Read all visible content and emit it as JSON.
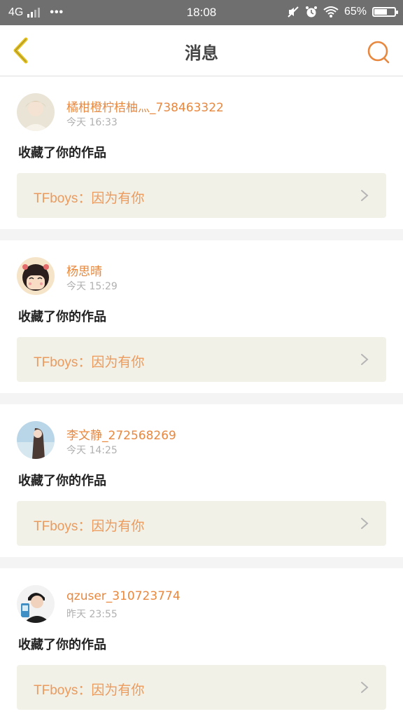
{
  "status_bar": {
    "network": "4G",
    "time": "18:08",
    "battery_percent": "65%",
    "battery_level": 0.65,
    "icons": [
      "signal-icon",
      "more-dots-icon",
      "mute-icon",
      "alarm-icon",
      "wifi-icon",
      "battery-icon"
    ]
  },
  "header": {
    "title": "消息",
    "back_icon": "chevron-left-icon",
    "search_icon": "search-icon"
  },
  "colors": {
    "accent": "#e8883f",
    "back_icon": "#e6c21c",
    "card_bg": "#f2f1e8"
  },
  "messages": [
    {
      "username": "橘柑橙柠桔柚灬_738463322",
      "time": "今天 16:33",
      "action": "收藏了你的作品",
      "work_title": "TFboys：因为有你"
    },
    {
      "username": "杨思晴",
      "time": "今天 15:29",
      "action": "收藏了你的作品",
      "work_title": "TFboys：因为有你"
    },
    {
      "username": "李文静_272568269",
      "time": "今天 14:25",
      "action": "收藏了你的作品",
      "work_title": "TFboys：因为有你"
    },
    {
      "username": "qzuser_310723774",
      "time": "昨天 23:55",
      "action": "收藏了你的作品",
      "work_title": "TFboys：因为有你"
    }
  ]
}
